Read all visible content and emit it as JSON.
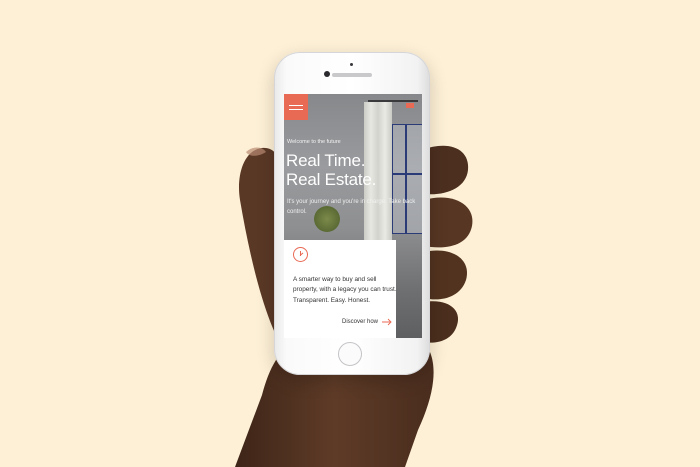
{
  "site": {
    "eyebrow": "Welcome to the future",
    "headline_line1": "Real Time.",
    "headline_line2": "Real Estate.",
    "subtext": "It's your journey and you're in charge. Take back control.",
    "card_text": "A smarter way to buy and sell property, with a legacy you can trust. Transparent. Easy. Honest.",
    "cta": "Discover how"
  },
  "colors": {
    "background": "#fdf0d6",
    "accent": "#e96a54",
    "skin": "#5b3a27"
  },
  "icons": {
    "logo": "brand-logo-icon",
    "menu": "hamburger-menu-icon",
    "card": "clock-icon",
    "cta": "arrow-right-icon"
  }
}
